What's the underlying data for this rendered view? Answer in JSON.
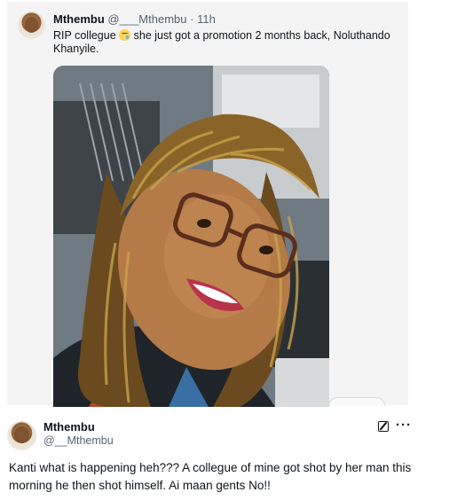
{
  "tweet1": {
    "display_name": "Mthembu",
    "handle": "@___Mthembu",
    "separator": "·",
    "time": "11h",
    "text_before_emoji": "RIP collegue",
    "emoji_icon": "crying-face-emoji-icon",
    "text_after_emoji": "she just got a promotion 2 months back, Noluthando Khanyile."
  },
  "tweet2": {
    "display_name": "Mthembu",
    "handle": "@__Mthembu",
    "text": "Kanti what is happening heh??? A collegue of mine got shot by her man this morning he then shot himself. Ai maan gents No!!",
    "more_label": "···"
  }
}
